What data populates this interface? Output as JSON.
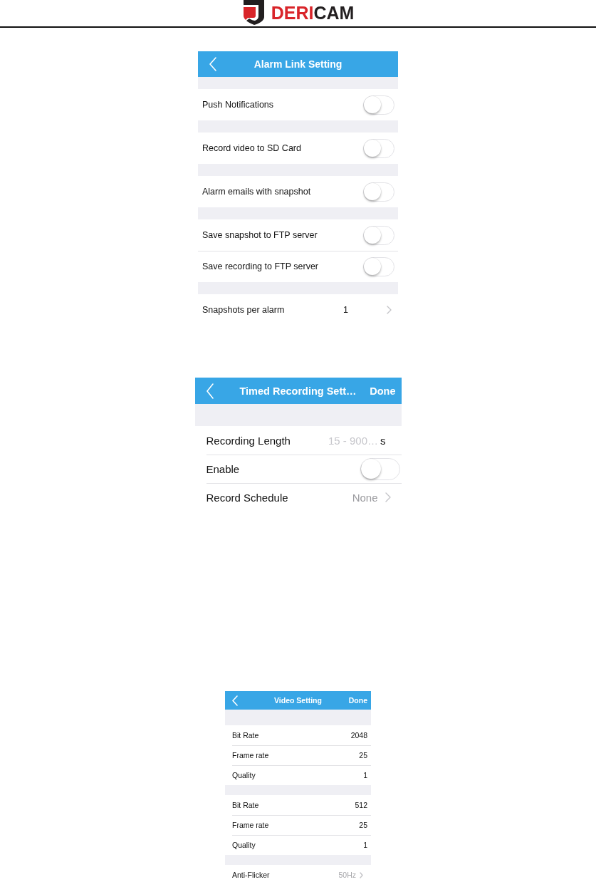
{
  "logo": {
    "accent": "DERI",
    "rest": "CAM"
  },
  "screens": [
    {
      "title": "Alarm Link Setting",
      "sections": [
        {
          "rows": [
            {
              "kind": "toggle",
              "label": "Push Notifications",
              "on": false
            }
          ]
        },
        {
          "rows": [
            {
              "kind": "toggle",
              "label": "Record video to SD Card",
              "on": false
            }
          ]
        },
        {
          "rows": [
            {
              "kind": "toggle",
              "label": "Alarm emails with snapshot",
              "on": false
            }
          ]
        },
        {
          "rows": [
            {
              "kind": "toggle",
              "label": "Save snapshot to FTP server",
              "on": false
            },
            {
              "kind": "toggle",
              "label": "Save recording to FTP server",
              "on": false
            }
          ]
        },
        {
          "rows": [
            {
              "kind": "picker",
              "label": "Snapshots per alarm",
              "value": "1"
            }
          ]
        }
      ]
    },
    {
      "title": "Timed Recording Sett…",
      "done": "Done",
      "sections": [
        {
          "rows": [
            {
              "kind": "input",
              "label": "Recording Length",
              "placeholder": "15 - 900…",
              "unit": "s"
            },
            {
              "kind": "toggle",
              "label": "Enable",
              "on": false
            },
            {
              "kind": "link",
              "label": "Record Schedule",
              "value": "None"
            }
          ]
        }
      ]
    },
    {
      "title": "Video Setting",
      "done": "Done",
      "sections": [
        {
          "rows": [
            {
              "kind": "value",
              "label": "Bit Rate",
              "value": "2048"
            },
            {
              "kind": "value",
              "label": "Frame rate",
              "value": "25"
            },
            {
              "kind": "value",
              "label": "Quality",
              "value": "1"
            }
          ]
        },
        {
          "rows": [
            {
              "kind": "value",
              "label": "Bit Rate",
              "value": "512"
            },
            {
              "kind": "value",
              "label": "Frame rate",
              "value": "25"
            },
            {
              "kind": "value",
              "label": "Quality",
              "value": "1"
            }
          ]
        },
        {
          "rows": [
            {
              "kind": "link",
              "label": "Anti-Flicker",
              "value": "50Hz"
            }
          ]
        }
      ]
    }
  ]
}
